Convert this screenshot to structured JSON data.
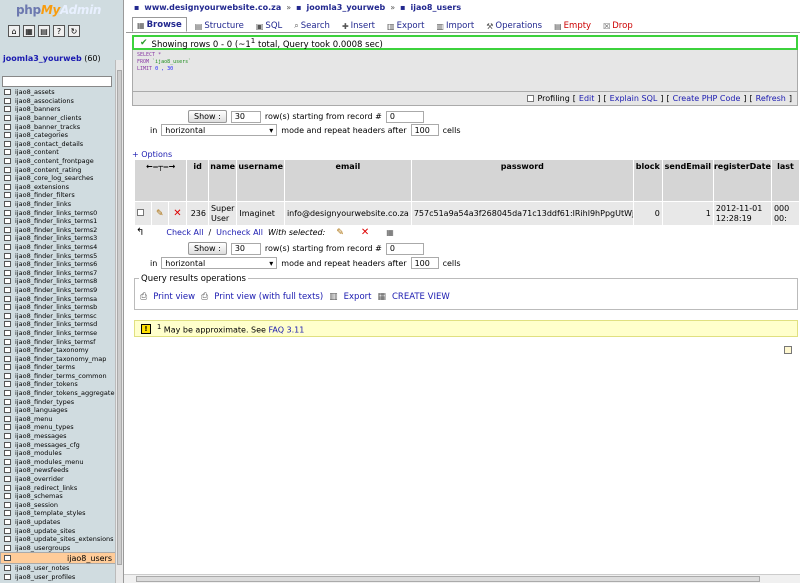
{
  "nav": {
    "logo": {
      "php": "php",
      "my": "My",
      "admin": "Admin"
    },
    "db_label": "joomla3_yourweb",
    "db_count": "(60)",
    "tables": [
      "ijao8_assets",
      "ijao8_associations",
      "ijao8_banners",
      "ijao8_banner_clients",
      "ijao8_banner_tracks",
      "ijao8_categories",
      "ijao8_contact_details",
      "ijao8_content",
      "ijao8_content_frontpage",
      "ijao8_content_rating",
      "ijao8_core_log_searches",
      "ijao8_extensions",
      "ijao8_finder_filters",
      "ijao8_finder_links",
      "ijao8_finder_links_terms0",
      "ijao8_finder_links_terms1",
      "ijao8_finder_links_terms2",
      "ijao8_finder_links_terms3",
      "ijao8_finder_links_terms4",
      "ijao8_finder_links_terms5",
      "ijao8_finder_links_terms6",
      "ijao8_finder_links_terms7",
      "ijao8_finder_links_terms8",
      "ijao8_finder_links_terms9",
      "ijao8_finder_links_termsa",
      "ijao8_finder_links_termsb",
      "ijao8_finder_links_termsc",
      "ijao8_finder_links_termsd",
      "ijao8_finder_links_termse",
      "ijao8_finder_links_termsf",
      "ijao8_finder_taxonomy",
      "ijao8_finder_taxonomy_map",
      "ijao8_finder_terms",
      "ijao8_finder_terms_common",
      "ijao8_finder_tokens",
      "ijao8_finder_tokens_aggregate",
      "ijao8_finder_types",
      "ijao8_languages",
      "ijao8_menu",
      "ijao8_menu_types",
      "ijao8_messages",
      "ijao8_messages_cfg",
      "ijao8_modules",
      "ijao8_modules_menu",
      "ijao8_newsfeeds",
      "ijao8_overrider",
      "ijao8_redirect_links",
      "ijao8_schemas",
      "ijao8_session",
      "ijao8_template_styles",
      "ijao8_updates",
      "ijao8_update_sites",
      "ijao8_update_sites_extensions",
      "ijao8_usergroups",
      "ijao8_users",
      "ijao8_user_notes",
      "ijao8_user_profiles"
    ],
    "selected_table": "ijao8_users"
  },
  "breadcrumb": {
    "server": "www.designyourwebsite.co.za",
    "db": "joomla3_yourweb",
    "table": "ijao8_users"
  },
  "tabs": [
    {
      "label": "Browse",
      "icon": "browse-icon"
    },
    {
      "label": "Structure",
      "icon": "structure-icon"
    },
    {
      "label": "SQL",
      "icon": "sql-icon"
    },
    {
      "label": "Search",
      "icon": "search-icon"
    },
    {
      "label": "Insert",
      "icon": "insert-icon"
    },
    {
      "label": "Export",
      "icon": "export-icon"
    },
    {
      "label": "Import",
      "icon": "import-icon"
    },
    {
      "label": "Operations",
      "icon": "operations-icon"
    },
    {
      "label": "Empty",
      "icon": "empty-icon"
    },
    {
      "label": "Drop",
      "icon": "drop-icon"
    }
  ],
  "message": {
    "text": "Showing rows 0 - 0 (~1",
    "sup": "1",
    "text2": " total, Query took 0.0008 sec)"
  },
  "sql": {
    "line1": "SELECT *",
    "line2a": "FROM ",
    "line2b": "`ijao8_users`",
    "line3a": "LIMIT ",
    "line3b": "0 , 30"
  },
  "sql_links": {
    "profiling": "Profiling",
    "edit": "Edit",
    "explain": "Explain SQL",
    "php": "Create PHP Code",
    "refresh": "Refresh"
  },
  "paging": {
    "show": "Show :",
    "rows": "30",
    "rows_text": "row(s) starting from record #",
    "start": "0",
    "in": "in",
    "mode": "horizontal",
    "mode_text": "mode and repeat headers after",
    "repeat": "100",
    "cells": "cells"
  },
  "options_link": "+ Options",
  "grid": {
    "headers": [
      "id",
      "name",
      "username",
      "email",
      "password",
      "block",
      "sendEmail",
      "registerDate",
      "last"
    ],
    "rows": [
      {
        "id": "236",
        "name": "Super User",
        "username": "Imaginet",
        "email": "info@designyourwebsite.co.za",
        "password": "757c51a9a54a3f268045da71c13ddf61:lRihl9hPpgUtWjX04...",
        "block": "0",
        "sendEmail": "1",
        "registerDate": "2012-11-01 12:28:19",
        "last": "000 00:"
      }
    ]
  },
  "row_ops": {
    "check_all": "Check All",
    "slash": "/",
    "uncheck_all": "Uncheck All",
    "with_selected": "With selected:"
  },
  "qro": {
    "title": "Query results operations",
    "print": "Print view",
    "print_full": "Print view (with full texts)",
    "export": "Export",
    "create_view": "CREATE VIEW"
  },
  "notice": {
    "sup": "1",
    "text": " May be approximate. See ",
    "link": "FAQ 3.11"
  }
}
